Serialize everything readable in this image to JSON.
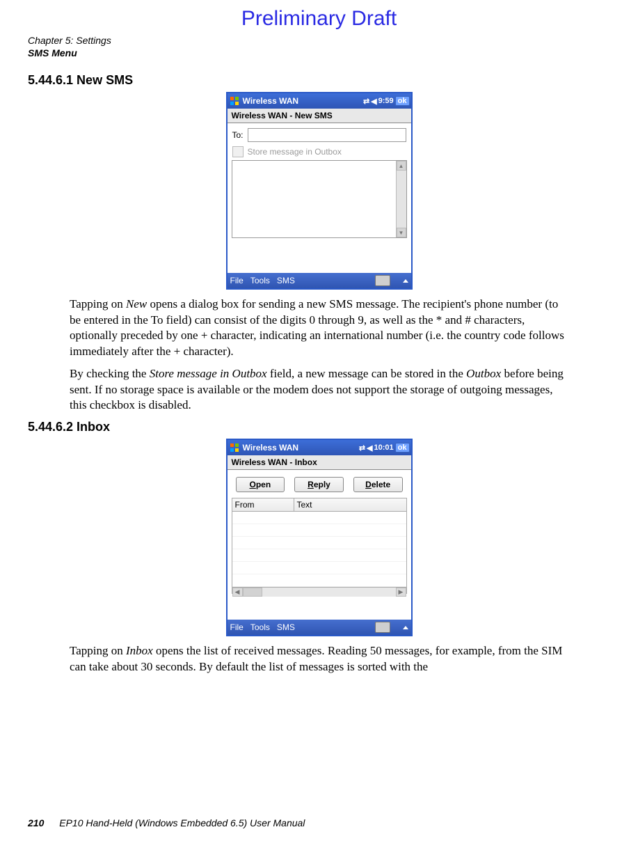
{
  "watermark": "Preliminary Draft",
  "header": {
    "chapter": "Chapter 5: Settings",
    "section": "SMS Menu"
  },
  "sec1": {
    "heading": "5.44.6.1 New SMS",
    "para1": "Tapping on New opens a dialog box for sending a new SMS message. The recipient's phone number (to be entered in the To field) can consist of the digits 0 through 9, as well as the * and # characters, optionally preceded by one + character, indicating an international number (i.e. the country code follows immediately after the + character).",
    "para2": "By checking the Store message in Outbox field, a new message can be stored in the Outbox before being sent. If no storage space is available or the modem does not support the storage of outgoing messages, this checkbox is disabled."
  },
  "sec2": {
    "heading": "5.44.6.2 Inbox",
    "para1": "Tapping on Inbox opens the list of received messages. Reading 50 messages, for example, from the SIM can take about 30 seconds. By default the list of messages is sorted with the"
  },
  "fig1": {
    "app_title": "Wireless WAN",
    "time": "9:59",
    "ok": "ok",
    "subtitle": "Wireless WAN - New SMS",
    "to_label": "To:",
    "checkbox_label": "Store message in Outbox",
    "menu": {
      "file": "File",
      "tools": "Tools",
      "sms": "SMS"
    }
  },
  "fig2": {
    "app_title": "Wireless WAN",
    "time": "10:01",
    "ok": "ok",
    "subtitle": "Wireless WAN - Inbox",
    "buttons": {
      "open": "Open",
      "reply": "Reply",
      "delete": "Delete"
    },
    "columns": {
      "from": "From",
      "text": "Text"
    },
    "menu": {
      "file": "File",
      "tools": "Tools",
      "sms": "SMS"
    }
  },
  "footer": {
    "page": "210",
    "doc": "EP10 Hand-Held (Windows Embedded 6.5) User Manual"
  }
}
